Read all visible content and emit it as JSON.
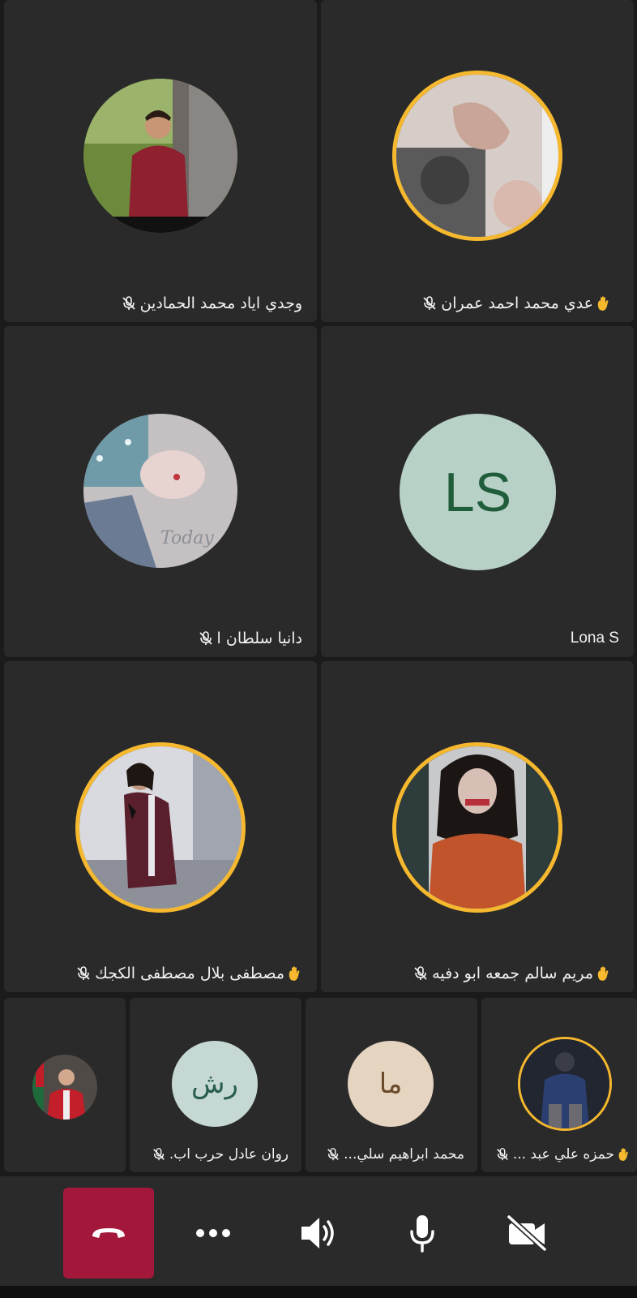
{
  "participants_large": [
    {
      "name": "وجدي اياد محمد الحمادين",
      "muted": true,
      "hand_raised": false,
      "speaking": false,
      "avatar": "photo-man-red-shirt"
    },
    {
      "name": "عدي محمد احمد عمران",
      "muted": true,
      "hand_raised": true,
      "speaking": true,
      "avatar": "photo-hands-blurred"
    },
    {
      "name": "دانيا سلطان ا",
      "muted": true,
      "hand_raised": false,
      "speaking": false,
      "avatar": "photo-girl-selfie"
    },
    {
      "name": "Lona S",
      "muted": false,
      "hand_raised": false,
      "speaking": false,
      "initials": "LS",
      "initials_bg": "#b8d1c6",
      "initials_color": "#1f5d3b"
    },
    {
      "name": "مصطفى بلال مصطفى الكجك",
      "muted": true,
      "hand_raised": true,
      "speaking": true,
      "avatar": "photo-man-plaid-shirt"
    },
    {
      "name": "مريم سالم جمعه ابو دفيه",
      "muted": true,
      "hand_raised": true,
      "speaking": true,
      "avatar": "photo-woman-hijab"
    }
  ],
  "participants_small": [
    {
      "name": "",
      "muted": false,
      "hand_raised": false,
      "speaking": false,
      "avatar": "photo-man-red-gown"
    },
    {
      "name": "روان عادل حرب اب.",
      "muted": true,
      "hand_raised": false,
      "speaking": false,
      "initials": "رش",
      "initials_bg": "#c5d8d4",
      "initials_color": "#285e51"
    },
    {
      "name": "محمد ابراهيم سلي...",
      "muted": true,
      "hand_raised": false,
      "speaking": false,
      "initials": "ما",
      "initials_bg": "#e4d4c0",
      "initials_color": "#6b4b2a"
    },
    {
      "name": "حمزه علي عبد ...",
      "muted": true,
      "hand_raised": true,
      "speaking": true,
      "avatar": "photo-man-dark-night"
    }
  ],
  "toolbar": {
    "buttons": [
      "hang-up",
      "more-options",
      "speaker",
      "microphone",
      "camera-off"
    ],
    "hangup_color": "#a3183a"
  },
  "colors": {
    "speaking_ring": "#f5b82e",
    "tile_bg": "#2a2a2a",
    "page_bg": "#1b1b1b"
  }
}
